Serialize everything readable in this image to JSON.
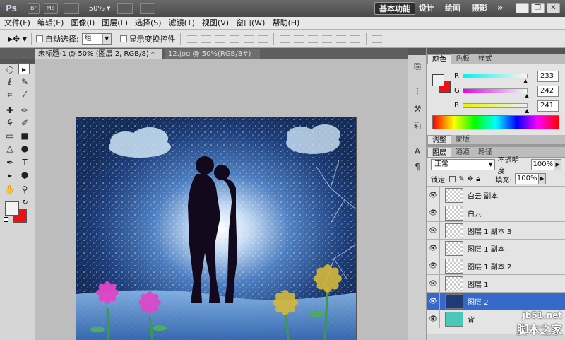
{
  "titlebar": {
    "app_logo": "Ps",
    "btn_br": "Br",
    "btn_mb": "Mb",
    "zoom": "50%",
    "workspaces": [
      "基本功能",
      "设计",
      "绘画",
      "摄影"
    ],
    "more": "»",
    "win_minimize": "–",
    "win_restore": "❐",
    "win_close": "✕"
  },
  "menubar": {
    "items": [
      "文件(F)",
      "编辑(E)",
      "图像(I)",
      "图层(L)",
      "选择(S)",
      "滤镜(T)",
      "视图(V)",
      "窗口(W)",
      "帮助(H)"
    ]
  },
  "options": {
    "auto_select_label": "自动选择:",
    "auto_select_value": "组",
    "show_transform_label": "显示变换控件"
  },
  "document_tabs": [
    {
      "label": "未标题-1 @ 50% (图层 2, RGB/8) *",
      "active": true
    },
    {
      "label": "12.jpg @ 50%(RGB/8#)",
      "active": false
    }
  ],
  "color_panel": {
    "tabs": [
      "颜色",
      "色板",
      "样式"
    ],
    "channels": [
      {
        "label": "R",
        "value": "233"
      },
      {
        "label": "G",
        "value": "242"
      },
      {
        "label": "B",
        "value": "241"
      }
    ],
    "foreground": "#e9f2f1",
    "background": "#ee1111"
  },
  "adjust_tabs": [
    "调整",
    "蒙版"
  ],
  "layers_panel": {
    "tabs": [
      "图层",
      "通道",
      "路径"
    ],
    "blend_mode": "正常",
    "opacity_label": "不透明度:",
    "opacity_value": "100%",
    "lock_label": "锁定:",
    "fill_label": "填充:",
    "fill_value": "100%",
    "layers": [
      {
        "name": "白云 副本",
        "selected": false
      },
      {
        "name": "白云",
        "selected": false
      },
      {
        "name": "图层 1 副本 3",
        "selected": false
      },
      {
        "name": "图层 1 副本",
        "selected": false
      },
      {
        "name": "图层 1 副本 2",
        "selected": false
      },
      {
        "name": "图层 1",
        "selected": false
      },
      {
        "name": "图层 2",
        "selected": true
      },
      {
        "name": "背",
        "selected": false
      }
    ]
  },
  "watermark": {
    "site": "jb51.net",
    "name": "脚本之家"
  }
}
